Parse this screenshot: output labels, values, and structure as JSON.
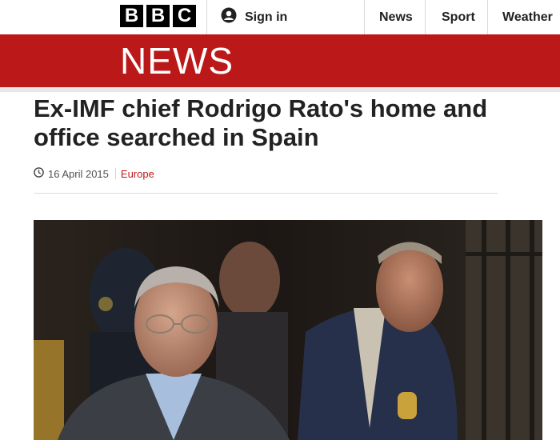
{
  "header": {
    "logo_letters": [
      "B",
      "B",
      "C"
    ],
    "signin_label": "Sign in",
    "signin_icon": "user-icon",
    "nav": [
      "News",
      "Sport",
      "Weather"
    ]
  },
  "banner": {
    "title": "NEWS",
    "color": "#bb1919"
  },
  "article": {
    "headline": "Ex-IMF chief Rodrigo Rato's home and office searched in Spain",
    "date": "16 April 2015",
    "date_icon": "clock-icon",
    "section": "Europe",
    "section_color": "#bb1919"
  },
  "photo": {
    "kind": "press-photo"
  }
}
